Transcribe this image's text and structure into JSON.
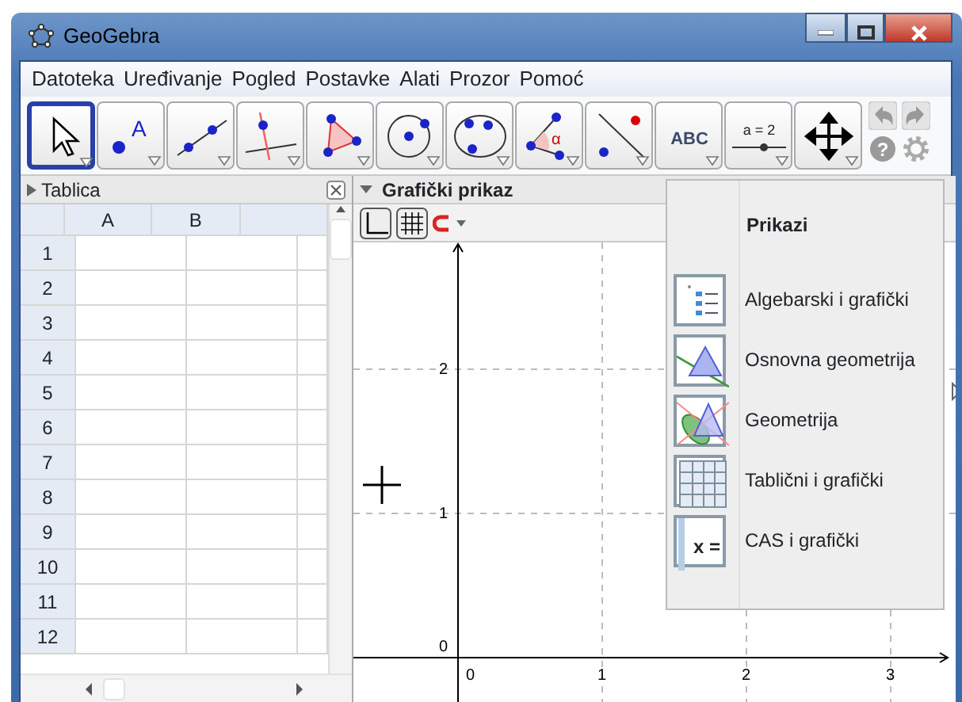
{
  "window": {
    "title": "GeoGebra"
  },
  "menu": [
    "Datoteka",
    "Uređivanje",
    "Pogled",
    "Postavke",
    "Alati",
    "Prozor",
    "Pomoć"
  ],
  "tools": [
    {
      "kind": "move",
      "selected": true
    },
    {
      "kind": "point",
      "label": "A",
      "selected": false
    },
    {
      "kind": "line",
      "selected": false
    },
    {
      "kind": "perpendicular",
      "selected": false
    },
    {
      "kind": "polygon",
      "selected": false
    },
    {
      "kind": "circle",
      "selected": false
    },
    {
      "kind": "conic",
      "selected": false
    },
    {
      "kind": "angle",
      "label": "α",
      "selected": false
    },
    {
      "kind": "reflect",
      "selected": false
    },
    {
      "kind": "text",
      "label": "ABC",
      "selected": false
    },
    {
      "kind": "slider",
      "label": "a = 2",
      "selected": false
    },
    {
      "kind": "move-view",
      "selected": false
    }
  ],
  "spreadsheet": {
    "title": "Tablica",
    "columns": [
      "A",
      "B"
    ],
    "rows": [
      "1",
      "2",
      "3",
      "4",
      "5",
      "6",
      "7",
      "8",
      "9",
      "10",
      "11",
      "12"
    ]
  },
  "help": {
    "label": "?"
  },
  "graphics": {
    "title": "Grafički prikaz",
    "x_ticks": [
      "0",
      "1",
      "2",
      "3"
    ],
    "y_ticks": [
      "2",
      "1",
      "0"
    ]
  },
  "perspectives": {
    "title": "Prikazi",
    "items": [
      {
        "kind": "algebra",
        "label": "Algebarski i grafički"
      },
      {
        "kind": "basic-geometry",
        "label": "Osnovna geometrija"
      },
      {
        "kind": "geometry",
        "label": "Geometrija"
      },
      {
        "kind": "spreadsheet",
        "label": "Tablični i grafički"
      },
      {
        "kind": "cas",
        "icon_text": "x =",
        "label": "CAS i grafički"
      }
    ]
  }
}
